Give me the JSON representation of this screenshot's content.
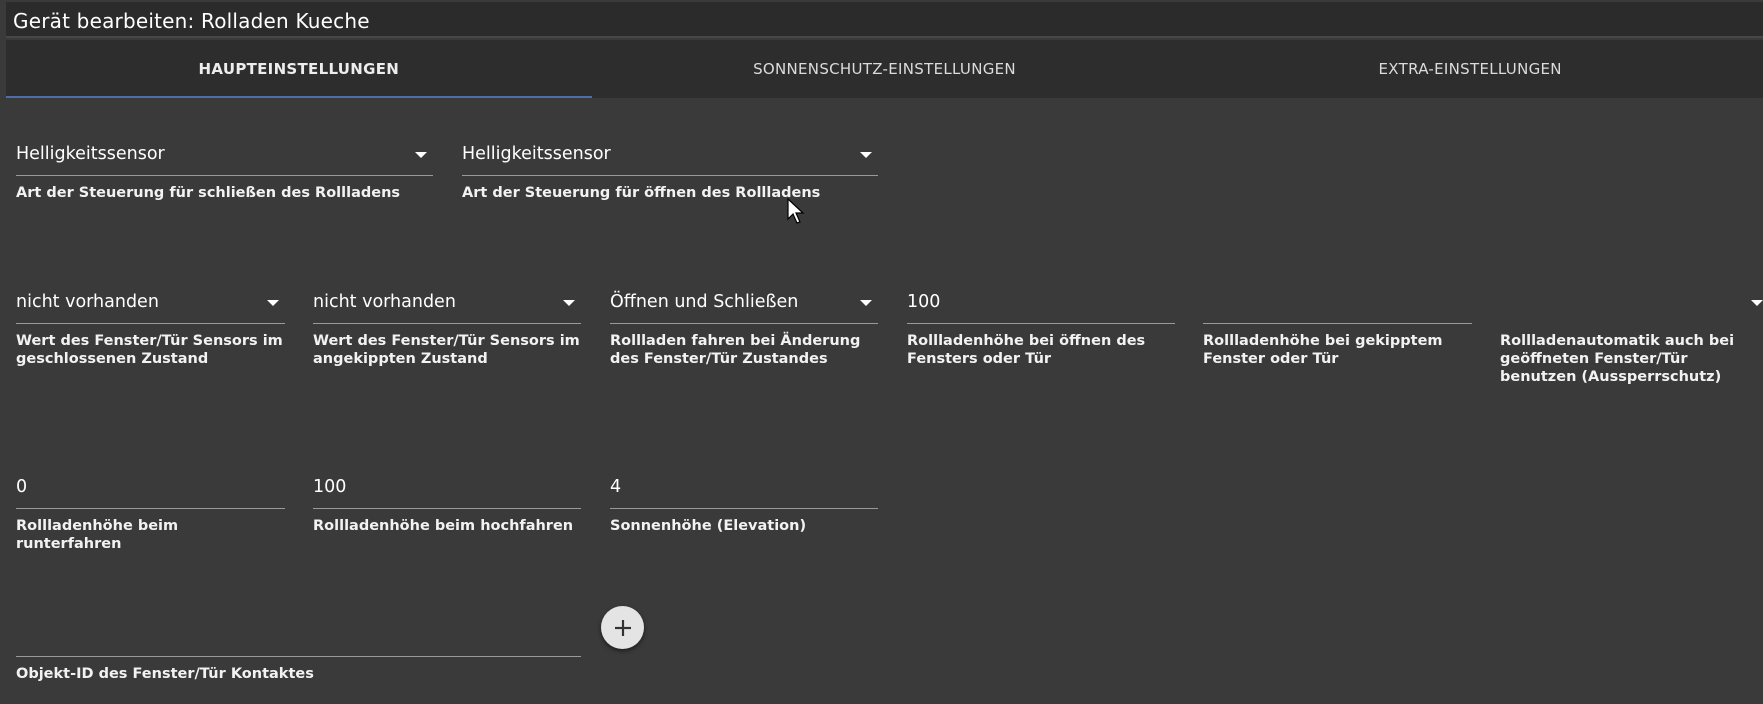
{
  "dialog": {
    "title": "Gerät bearbeiten: Rolladen Kueche"
  },
  "tabs": [
    {
      "label": "HAUPTEINSTELLUNGEN",
      "active": true
    },
    {
      "label": "SONNENSCHUTZ-EINSTELLUNGEN",
      "active": false
    },
    {
      "label": "EXTRA-EINSTELLUNGEN",
      "active": false
    }
  ],
  "row1": {
    "close_control": {
      "value": "Helligkeitssensor",
      "label": "Art der Steuerung für schließen des Rollladens"
    },
    "open_control": {
      "value": "Helligkeitssensor",
      "label": "Art der Steuerung für öffnen des Rollladens"
    }
  },
  "row2": {
    "sensor_closed": {
      "value": "nicht vorhanden",
      "label": "Wert des Fenster/Tür Sensors im geschlossenen Zustand"
    },
    "sensor_tilted": {
      "value": "nicht vorhanden",
      "label": "Wert des Fenster/Tür Sensors im angekippten Zustand"
    },
    "drive_on_change": {
      "value": "Öffnen und Schließen",
      "label": "Rollladen fahren bei Änderung des Fenster/Tür Zustandes"
    },
    "height_open_window": {
      "value": "100",
      "label": "Rollladenhöhe bei öffnen des Fensters oder Tür"
    },
    "height_tilted_window": {
      "value": "",
      "label": "Rollladenhöhe bei gekipptem Fenster oder Tür"
    },
    "lockout_protection": {
      "value": "",
      "label": "Rollladenautomatik auch bei geöffneten Fenster/Tür benutzen (Aussperrschutz)"
    }
  },
  "row3": {
    "height_down": {
      "value": "0",
      "label": "Rollladenhöhe beim runterfahren"
    },
    "height_up": {
      "value": "100",
      "label": "Rollladenhöhe beim hochfahren"
    },
    "sun_elevation": {
      "value": "4",
      "label": "Sonnenhöhe (Elevation)"
    }
  },
  "row4": {
    "object_id": {
      "value": "",
      "label": "Objekt-ID des Fenster/Tür Kontaktes"
    }
  },
  "icons": {
    "add": "plus-icon",
    "dropdown": "caret-down-icon",
    "cursor": "mouse-pointer-icon"
  }
}
